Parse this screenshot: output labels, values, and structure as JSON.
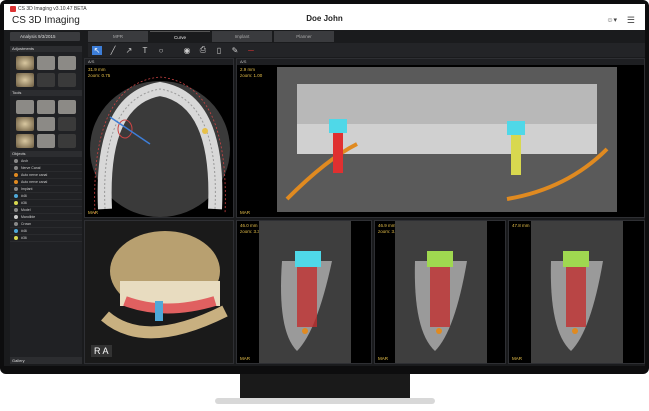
{
  "window": {
    "app_title": "CS 3D Imaging v3.10.47 BETA",
    "brand": "CS 3D Imaging",
    "patient": "Doe John"
  },
  "analysis": "Analysis 9/3/2015",
  "tabs": [
    "MPR",
    "Curve",
    "Implant",
    "Planner"
  ],
  "left": {
    "adjustments": "Adjustments",
    "tools": "Tools",
    "objects": "Objects",
    "gallery": "Gallery",
    "object_rows": [
      {
        "label": "Arch",
        "color": "#888888"
      },
      {
        "label": "Nerve Canal",
        "color": "#888888"
      },
      {
        "label": "Auto nerve canal",
        "color": "#e08a20"
      },
      {
        "label": "Auto nerve canal",
        "color": "#e08a20"
      },
      {
        "label": "Implant",
        "color": "#888888"
      },
      {
        "label": "#46",
        "color": "#4fa8d8"
      },
      {
        "label": "#36",
        "color": "#d8d84f"
      },
      {
        "label": "Model",
        "color": "#888888"
      },
      {
        "label": "Mandible",
        "color": "#cccccc"
      },
      {
        "label": "Crown",
        "color": "#888888"
      },
      {
        "label": "#46",
        "color": "#4fa8d8"
      },
      {
        "label": "#36",
        "color": "#d8d84f"
      }
    ]
  },
  "views": {
    "axial": {
      "header": "A/S",
      "thickness": "31.9 mm",
      "zoom": "zoom: 0.75",
      "mar": "MAR"
    },
    "pano": {
      "header": "A/S",
      "thickness": "2.9 mm",
      "zoom": "zoom: 1.00",
      "mar": "MAR"
    },
    "model3d": {
      "badge": "R A"
    },
    "xs1": {
      "value": "46.0 mm",
      "zoom": "zoom: 3.30",
      "mar": "MAR"
    },
    "xs2": {
      "value": "46.9 mm",
      "zoom": "zoom: 3.30",
      "mar": "MAR"
    },
    "xs3": {
      "value": "47.8 mm",
      "mar": "MAR"
    }
  },
  "colors": {
    "accent": "#3d7ed8",
    "implant_blue": "#4fd8e8",
    "nerve": "#e08a20",
    "marker": "#e8c14a"
  }
}
